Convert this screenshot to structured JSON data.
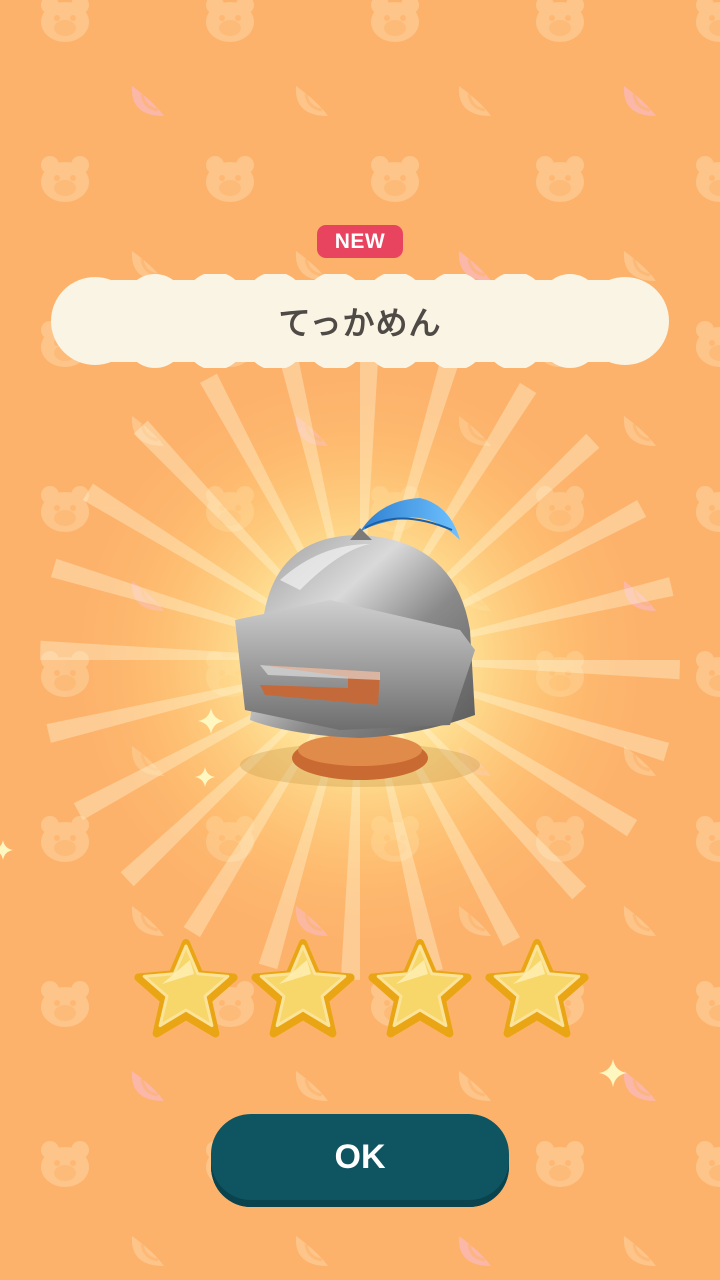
{
  "badge": {
    "label": "NEW"
  },
  "item": {
    "name": "てっかめん",
    "rarity_stars": 4,
    "rarity_max": 4
  },
  "buttons": {
    "ok_label": "OK"
  },
  "colors": {
    "background": "#fdb26b",
    "badge": "#e8445f",
    "title_cloud": "#f9f4e4",
    "button": "#0e5561",
    "star": "#f7d66a",
    "star_outline": "#e9a514"
  },
  "icons": {
    "background_pattern": [
      "bear-face-icon",
      "leaf-icon"
    ],
    "rarity": "star-icon"
  }
}
